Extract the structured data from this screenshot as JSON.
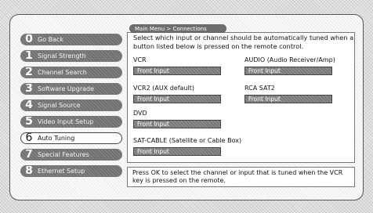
{
  "header": {
    "title": "Main Menu > Connections"
  },
  "menu": {
    "items": [
      {
        "num": "0",
        "label": "Go Back"
      },
      {
        "num": "1",
        "label": "Signal Strength"
      },
      {
        "num": "2",
        "label": "Channel Search"
      },
      {
        "num": "3",
        "label": "Software Upgrade"
      },
      {
        "num": "4",
        "label": "Signal Source"
      },
      {
        "num": "5",
        "label": "Video Input Setup"
      },
      {
        "num": "6",
        "label": "Auto Tuning"
      },
      {
        "num": "7",
        "label": "Special Features"
      },
      {
        "num": "8",
        "label": "Ethernet Setup"
      }
    ],
    "active_index": 6
  },
  "content": {
    "description": "Select which input or channel should be automatically tuned when a button listed below is pressed on the remote control.",
    "fields": [
      {
        "label": "VCR",
        "value": "Front Input"
      },
      {
        "label": "AUDIO (Audio Receiver/Amp)",
        "value": "Front Input"
      },
      {
        "label": "VCR2 (AUX default)",
        "value": "Front Input"
      },
      {
        "label": "RCA SAT2",
        "value": "Front Input"
      },
      {
        "label": "DVD",
        "value": "Front Input"
      },
      {
        "label": "SAT-CABLE (Satellite or Cable Box)",
        "value": "Front Input"
      }
    ]
  },
  "help": {
    "text": "Press OK to select the channel or input that is tuned when the VCR key is pressed on the remote."
  }
}
